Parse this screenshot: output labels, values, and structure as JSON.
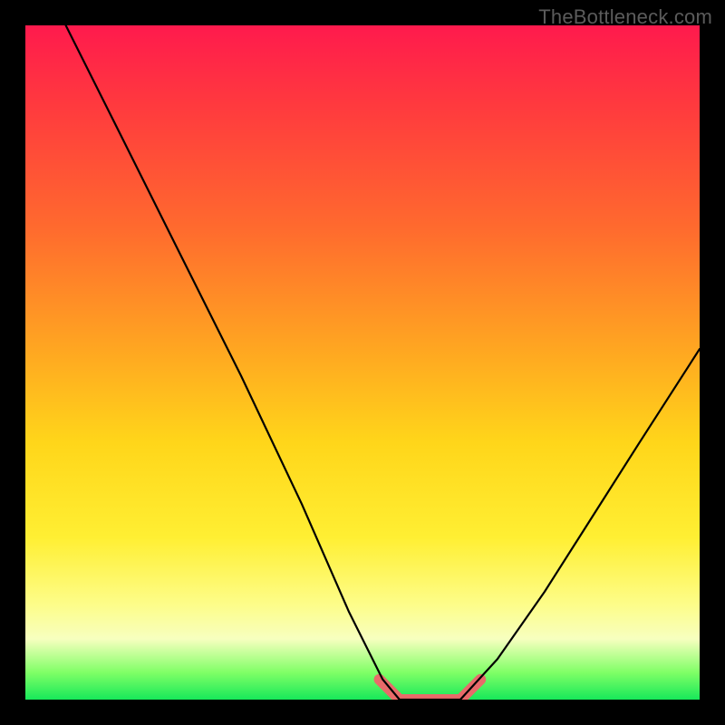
{
  "watermark": "TheBottleneck.com",
  "chart_data": {
    "type": "line",
    "title": "",
    "xlabel": "",
    "ylabel": "",
    "xlim": [
      0,
      1
    ],
    "ylim": [
      0,
      1
    ],
    "series": [
      {
        "name": "left-curve",
        "x": [
          0.06,
          0.14,
          0.23,
          0.32,
          0.41,
          0.48,
          0.53,
          0.555
        ],
        "y": [
          1.0,
          0.84,
          0.66,
          0.48,
          0.29,
          0.13,
          0.03,
          0.0
        ]
      },
      {
        "name": "bottom-flat",
        "x": [
          0.555,
          0.645
        ],
        "y": [
          0.0,
          0.0
        ]
      },
      {
        "name": "right-curve",
        "x": [
          0.645,
          0.7,
          0.77,
          0.84,
          0.91,
          1.0
        ],
        "y": [
          0.0,
          0.06,
          0.16,
          0.27,
          0.38,
          0.52
        ]
      }
    ],
    "annotations": [
      {
        "text": "TheBottleneck.com",
        "pos": "top-right"
      }
    ],
    "accent": {
      "name": "bottom-highlight",
      "color": "#e86a6a",
      "x": [
        0.525,
        0.555,
        0.645,
        0.675
      ],
      "y": [
        0.03,
        0.0,
        0.0,
        0.03
      ]
    },
    "gradient_stops": [
      {
        "pos": 0.0,
        "color": "#ff1a4d"
      },
      {
        "pos": 0.3,
        "color": "#ff6a2e"
      },
      {
        "pos": 0.62,
        "color": "#ffd61a"
      },
      {
        "pos": 0.88,
        "color": "#fdfd8a"
      },
      {
        "pos": 1.0,
        "color": "#17e85a"
      }
    ]
  }
}
